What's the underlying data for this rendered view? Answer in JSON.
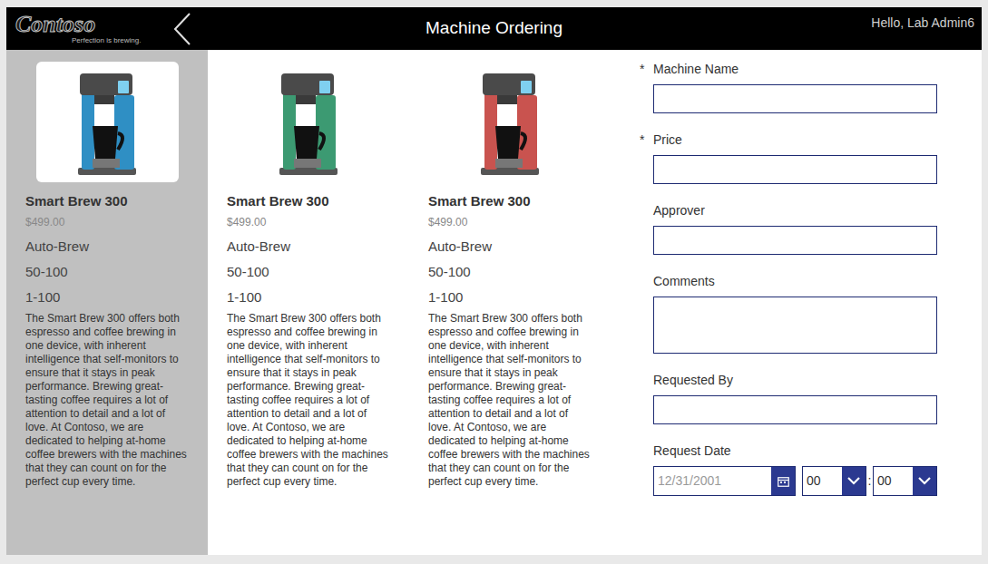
{
  "header": {
    "logo": "Contoso",
    "tagline": "Perfection is brewing.",
    "title": "Machine Ordering",
    "greeting": "Hello, Lab Admin6"
  },
  "products": [
    {
      "name": "Smart Brew 300",
      "price": "$499.00",
      "mode": "Auto-Brew",
      "cups": "50-100",
      "range": "1-100",
      "description": "The Smart Brew 300 offers both espresso and coffee brewing in one device, with inherent intelligence that self-monitors to ensure that it stays in peak performance. Brewing great-tasting coffee requires a lot of attention to detail and a lot of love. At Contoso, we are dedicated to helping at-home coffee brewers with the machines that they can count on for the perfect cup every time.",
      "color": "#2f8fc4",
      "selected": true
    },
    {
      "name": "Smart Brew 300",
      "price": "$499.00",
      "mode": "Auto-Brew",
      "cups": "50-100",
      "range": "1-100",
      "description": "The Smart Brew 300 offers both espresso and coffee brewing in one device, with inherent intelligence that self-monitors to ensure that it stays in peak performance. Brewing great-tasting coffee requires a lot of attention to detail and a lot of love. At Contoso, we are dedicated to helping at-home coffee brewers with the machines that they can count on for the perfect cup every time.",
      "color": "#3c9a72",
      "selected": false
    },
    {
      "name": "Smart Brew 300",
      "price": "$499.00",
      "mode": "Auto-Brew",
      "cups": "50-100",
      "range": "1-100",
      "description": "The Smart Brew 300 offers both espresso and coffee brewing in one device, with inherent intelligence that self-monitors to ensure that it stays in peak performance. Brewing great-tasting coffee requires a lot of attention to detail and a lot of love. At Contoso, we are dedicated to helping at-home coffee brewers with the machines that they can count on for the perfect cup every time.",
      "color": "#c9534f",
      "selected": false
    }
  ],
  "form": {
    "required_mark": "*",
    "fields": [
      {
        "label": "Machine Name",
        "required": true,
        "kind": "text"
      },
      {
        "label": "Price",
        "required": true,
        "kind": "text"
      },
      {
        "label": "Approver",
        "required": false,
        "kind": "text"
      },
      {
        "label": "Comments",
        "required": false,
        "kind": "multiline"
      },
      {
        "label": "Requested By",
        "required": false,
        "kind": "text"
      },
      {
        "label": "Request Date",
        "required": false,
        "kind": "date",
        "placeholder": "12/31/2001",
        "hour": "00",
        "minute": "00",
        "separator": ":"
      }
    ]
  }
}
